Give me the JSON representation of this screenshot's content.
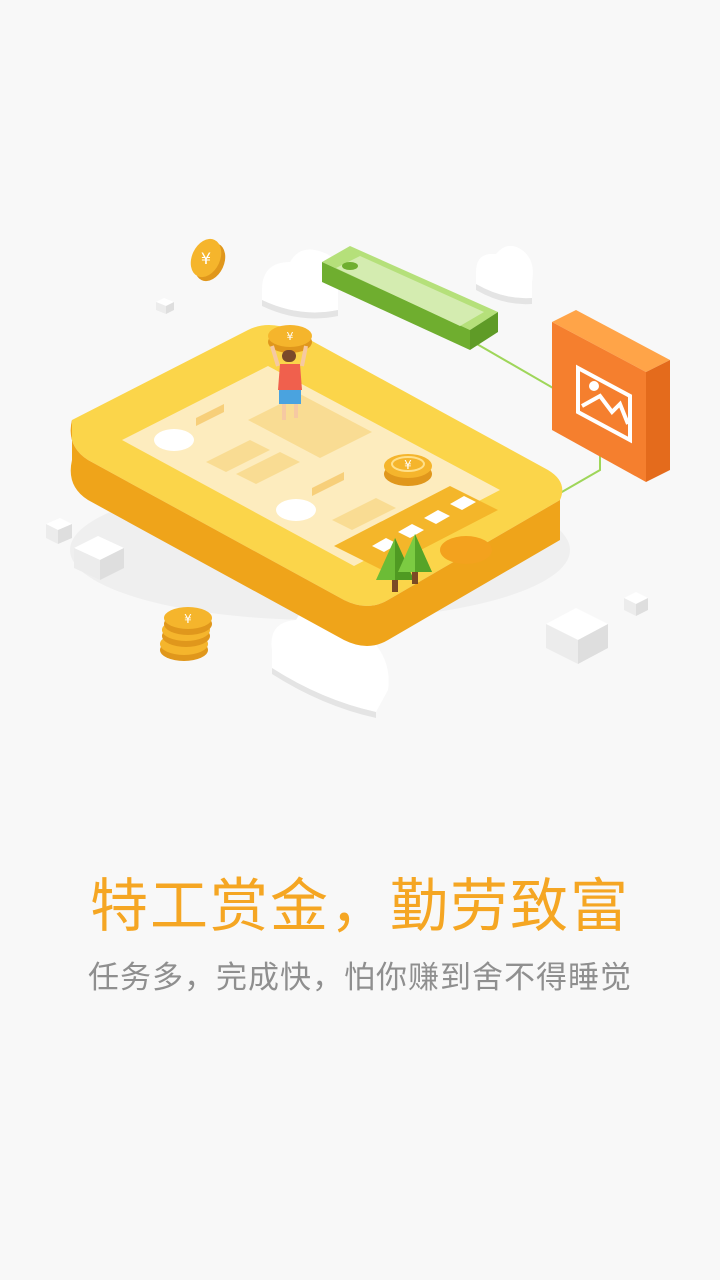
{
  "onboarding": {
    "headline": "特工赏金，勤劳致富",
    "subline": "任务多，完成快，怕你赚到舍不得睡觉"
  },
  "illustration": {
    "coin_symbol": "¥",
    "colors": {
      "phone": "#f9c92d",
      "phone_side": "#efa41a",
      "small_phone": "#86c73d",
      "photo_tile": "#f57f2e",
      "coin": "#f5b52c",
      "headline": "#f5a623",
      "subline": "#8f8f8f"
    }
  }
}
